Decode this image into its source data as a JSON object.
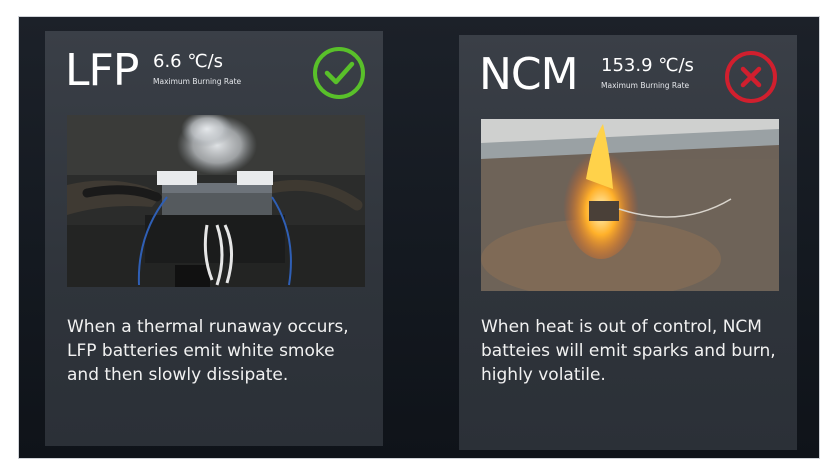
{
  "cards": [
    {
      "title": "LFP",
      "rate": "6.6 ℃/s",
      "rate_label": "Maximum Burning Rate",
      "status_icon": "check-circle-icon",
      "status_color": "#59c02a",
      "description_lines": [
        "When a thermal runaway occurs,",
        "LFP batteries emit white smoke",
        "and then slowly dissipate."
      ]
    },
    {
      "title": "NCM",
      "rate": "153.9 ℃/s",
      "rate_label": "Maximum Burning Rate",
      "status_icon": "x-circle-icon",
      "status_color": "#d11f2e",
      "description_lines": [
        "When heat is out of control, NCM",
        "batteies will emit sparks and burn,",
        "highly volatile."
      ]
    }
  ]
}
